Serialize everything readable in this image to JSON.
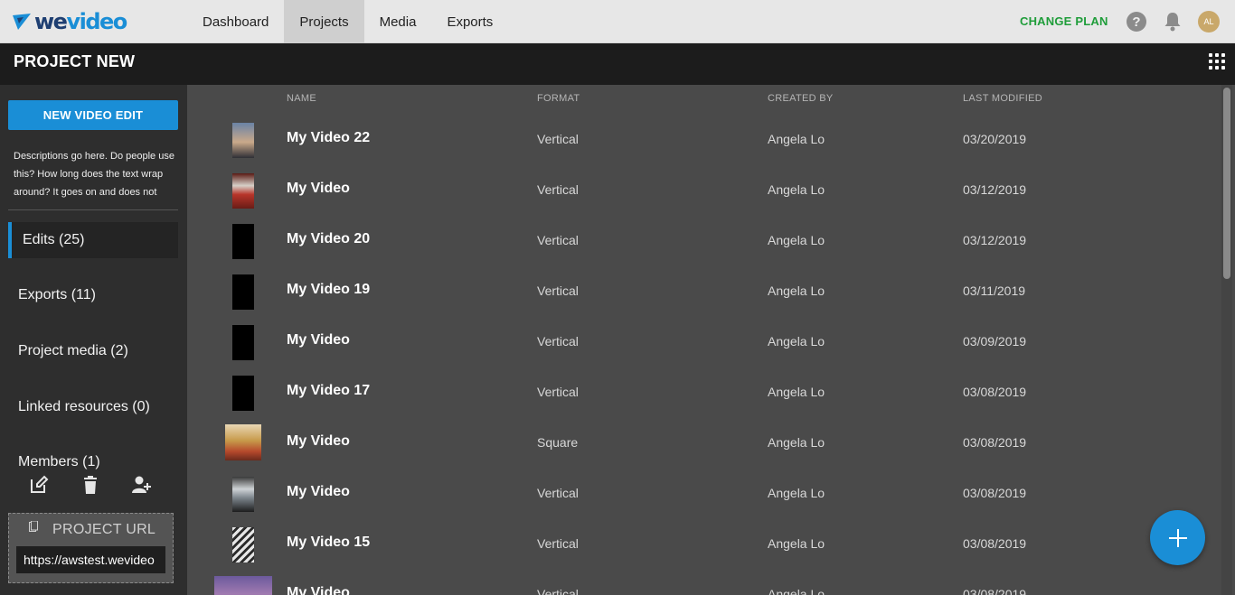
{
  "brand": {
    "name_part1": "we",
    "name_part2": "video"
  },
  "nav": {
    "items": [
      {
        "label": "Dashboard",
        "active": false
      },
      {
        "label": "Projects",
        "active": true
      },
      {
        "label": "Media",
        "active": false
      },
      {
        "label": "Exports",
        "active": false
      }
    ],
    "change_plan": "CHANGE PLAN",
    "help": "?",
    "avatar_initials": "AL"
  },
  "project": {
    "title": "PROJECT NEW"
  },
  "sidebar": {
    "new_button": "NEW VIDEO EDIT",
    "description": "Descriptions go here. Do people use this? How long does the text wrap around? It goes on and does not cap...",
    "items": [
      {
        "label": "Edits (25)",
        "active": true
      },
      {
        "label": "Exports (11)",
        "active": false
      },
      {
        "label": "Project media (2)",
        "active": false
      },
      {
        "label": "Linked resources (0)",
        "active": false
      },
      {
        "label": "Members (1)",
        "active": false
      }
    ],
    "project_url_label": "PROJECT URL",
    "project_url_value": "https://awstest.wevideo"
  },
  "table": {
    "headers": {
      "name": "NAME",
      "format": "FORMAT",
      "created_by": "CREATED BY",
      "last_modified": "LAST MODIFIED"
    },
    "rows": [
      {
        "name": "My Video 22",
        "format": "Vertical",
        "created_by": "Angela Lo",
        "last_modified": "03/20/2019",
        "thumb": "city-dusk"
      },
      {
        "name": "My Video",
        "format": "Vertical",
        "created_by": "Angela Lo",
        "last_modified": "03/12/2019",
        "thumb": "red-frames"
      },
      {
        "name": "My Video 20",
        "format": "Vertical",
        "created_by": "Angela Lo",
        "last_modified": "03/12/2019",
        "thumb": "black"
      },
      {
        "name": "My Video 19",
        "format": "Vertical",
        "created_by": "Angela Lo",
        "last_modified": "03/11/2019",
        "thumb": "black"
      },
      {
        "name": "My Video",
        "format": "Vertical",
        "created_by": "Angela Lo",
        "last_modified": "03/09/2019",
        "thumb": "black"
      },
      {
        "name": "My Video 17",
        "format": "Vertical",
        "created_by": "Angela Lo",
        "last_modified": "03/08/2019",
        "thumb": "black"
      },
      {
        "name": "My Video",
        "format": "Square",
        "created_by": "Angela Lo",
        "last_modified": "03/08/2019",
        "thumb": "autumn-field"
      },
      {
        "name": "My Video",
        "format": "Vertical",
        "created_by": "Angela Lo",
        "last_modified": "03/08/2019",
        "thumb": "cloudy-sky"
      },
      {
        "name": "My Video 15",
        "format": "Vertical",
        "created_by": "Angela Lo",
        "last_modified": "03/08/2019",
        "thumb": "keyboard"
      },
      {
        "name": "My Video",
        "format": "Vertical",
        "created_by": "Angela Lo",
        "last_modified": "03/08/2019",
        "thumb": "purple-landscape"
      }
    ]
  },
  "colors": {
    "accent": "#1a8ed6",
    "plan_green": "#1f9d3a",
    "main_bg": "#4a4a4a",
    "sidebar_bg": "#2e2e2e"
  },
  "icons": [
    "wevideo-logo-icon",
    "help-icon",
    "bell-icon",
    "avatar",
    "apps-grid-icon",
    "edit-icon",
    "trash-icon",
    "add-member-icon",
    "clipboard-icon",
    "plus-icon"
  ]
}
